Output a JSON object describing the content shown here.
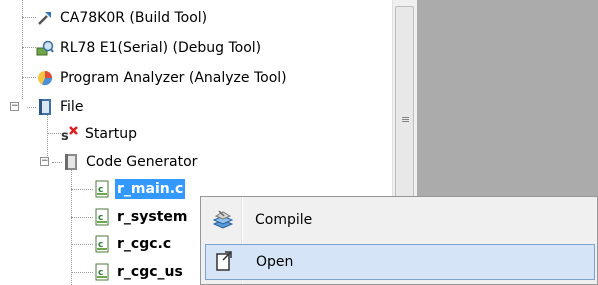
{
  "tree": {
    "items": [
      {
        "label": "CA78K0R (Build Tool)",
        "icon": "build-tool-icon",
        "bold": false,
        "selected": false
      },
      {
        "label": "RL78 E1(Serial) (Debug Tool)",
        "icon": "debug-tool-icon",
        "bold": false,
        "selected": false
      },
      {
        "label": "Program Analyzer (Analyze Tool)",
        "icon": "analyze-tool-icon",
        "bold": false,
        "selected": false
      },
      {
        "label": "File",
        "icon": "folder-icon",
        "bold": false,
        "selected": false
      },
      {
        "label": "Startup",
        "icon": "startup-icon",
        "bold": false,
        "selected": false
      },
      {
        "label": "Code Generator",
        "icon": "folder-icon",
        "bold": false,
        "selected": false
      },
      {
        "label": "r_main.c",
        "icon": "c-file-icon",
        "bold": true,
        "selected": true
      },
      {
        "label": "r_system",
        "icon": "c-file-icon",
        "bold": true,
        "selected": false
      },
      {
        "label": "r_cgc.c",
        "icon": "c-file-icon",
        "bold": true,
        "selected": false
      },
      {
        "label": "r_cgc_us",
        "icon": "c-file-icon",
        "bold": true,
        "selected": false
      }
    ],
    "expanders": {
      "file": "−",
      "code_generator": "−"
    }
  },
  "context_menu": {
    "items": [
      {
        "label": "Compile",
        "icon": "compile-icon",
        "highlighted": false
      },
      {
        "label": "Open",
        "icon": "open-file-icon",
        "highlighted": true
      }
    ]
  },
  "colors": {
    "selection": "#3399ff",
    "menu_highlight": "#d5e4f7",
    "menu_background": "#f0f0f0",
    "inactive_area": "#ababab"
  }
}
